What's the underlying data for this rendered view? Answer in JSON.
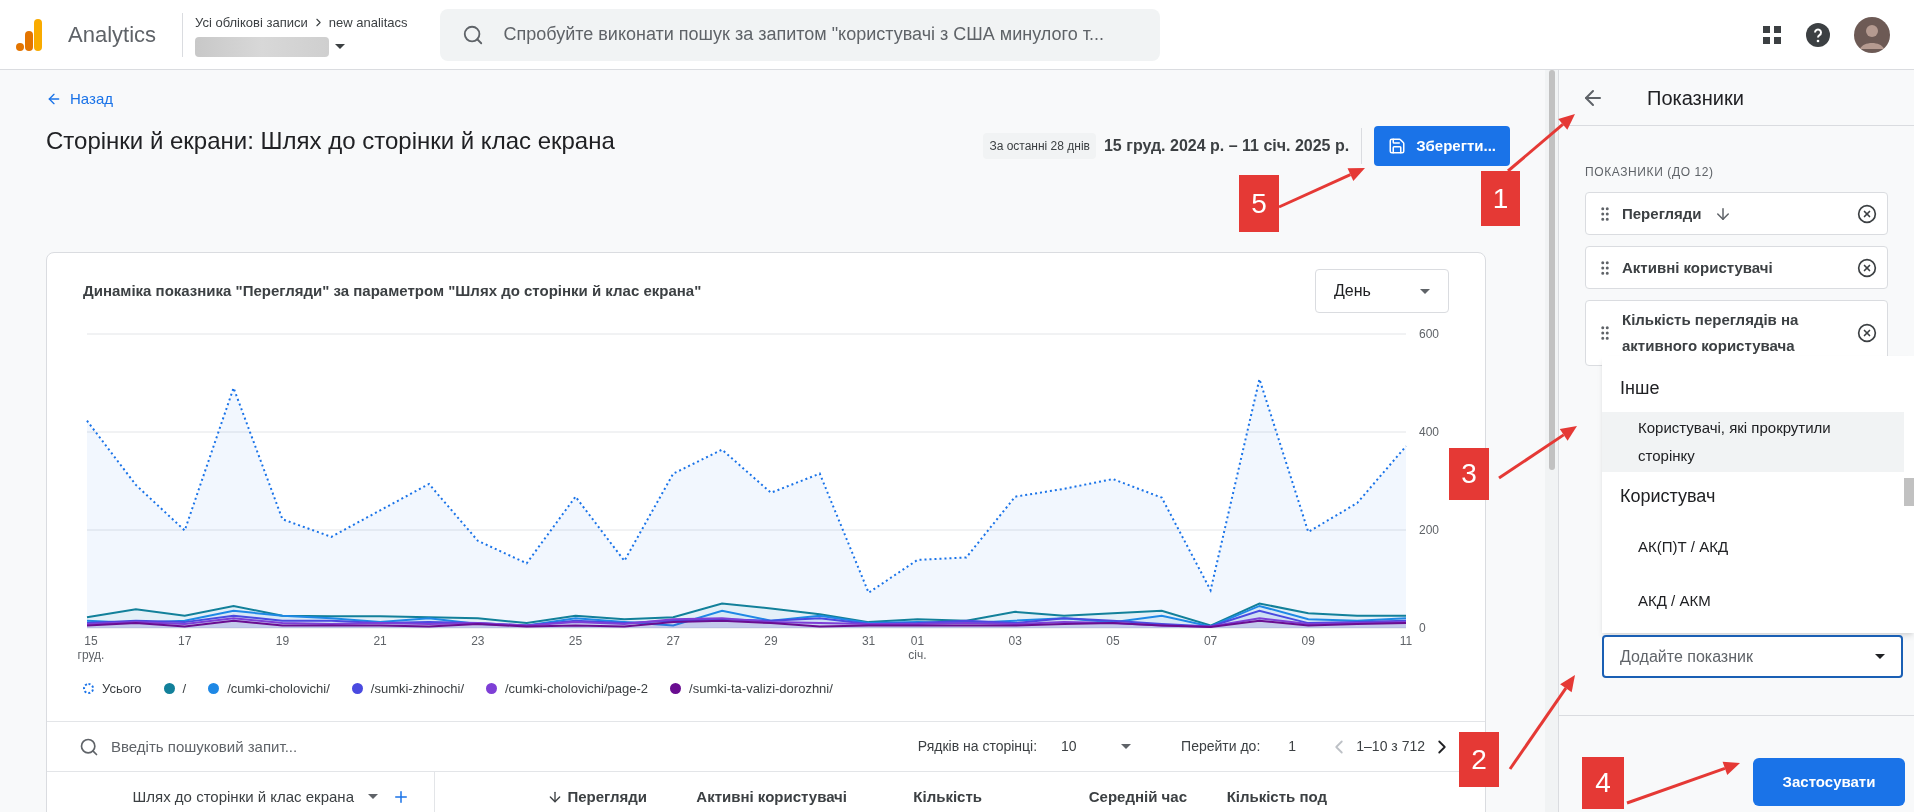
{
  "top_bar": {
    "product": "Analytics",
    "breadcrumb": [
      "Усі облікові записи",
      "new analitacs"
    ],
    "search": {
      "placeholder": "Спробуйте виконати пошук за запитом \"користувачі з США минулого т..."
    }
  },
  "header": {
    "back": "Назад",
    "title": "Сторінки й екрани: Шлях до сторінки й клас екрана",
    "date_range_label": "За останні 28 днів",
    "date_range": "15 груд. 2024 р. – 11 січ. 2025 р.",
    "save": "Зберегти..."
  },
  "chart_card": {
    "title": "Динаміка показника \"Перегляди\" за параметром \"Шлях до сторінки й клас екрана\"",
    "granularity": "День",
    "chart_data": {
      "type": "area",
      "categories": [
        "15 груд.",
        null,
        "17",
        null,
        "19",
        null,
        "21",
        null,
        "23",
        null,
        "25",
        null,
        "27",
        null,
        "29",
        null,
        "31",
        "01 січ.",
        null,
        "03",
        null,
        "05",
        null,
        "07",
        null,
        "09",
        null,
        "11"
      ],
      "yticks": [
        0,
        200,
        400,
        600
      ],
      "ylim": [
        0,
        600
      ],
      "series": [
        {
          "name": "Усього",
          "color": "#1a73e8",
          "line_style": "dotted",
          "values": [
            423,
            292,
            199,
            490,
            222,
            186,
            240,
            294,
            178,
            132,
            268,
            137,
            315,
            364,
            276,
            315,
            72,
            139,
            144,
            268,
            284,
            304,
            266,
            77,
            508,
            196,
            255,
            371
          ]
        },
        {
          "name": "/",
          "color": "#12809a",
          "line_style": "solid",
          "values": [
            22,
            38,
            25,
            45,
            25,
            24,
            24,
            22,
            20,
            10,
            25,
            18,
            22,
            50,
            40,
            28,
            12,
            18,
            15,
            33,
            25,
            30,
            35,
            5,
            50,
            30,
            25,
            25
          ]
        },
        {
          "name": "/cumki-cholovichi/",
          "color": "#1e88e5",
          "line_style": "solid",
          "values": [
            15,
            10,
            15,
            35,
            25,
            20,
            12,
            20,
            8,
            5,
            20,
            12,
            5,
            35,
            15,
            25,
            10,
            12,
            10,
            15,
            20,
            12,
            25,
            3,
            45,
            18,
            15,
            20
          ]
        },
        {
          "name": "/sumki-zhinochi/",
          "color": "#4a4ae0",
          "line_style": "solid",
          "values": [
            10,
            15,
            12,
            25,
            15,
            15,
            10,
            12,
            10,
            5,
            15,
            10,
            15,
            18,
            15,
            20,
            8,
            10,
            15,
            10,
            20,
            15,
            8,
            3,
            35,
            10,
            12,
            15
          ]
        },
        {
          "name": "/cumki-cholovichi/page-2",
          "color": "#7e3fd6",
          "line_style": "solid",
          "values": [
            8,
            12,
            8,
            20,
            10,
            8,
            10,
            8,
            10,
            5,
            12,
            8,
            18,
            20,
            12,
            10,
            8,
            8,
            10,
            8,
            12,
            10,
            5,
            3,
            20,
            8,
            10,
            12
          ]
        },
        {
          "name": "/sumki-ta-valizi-dorozhni/",
          "color": "#6a0d91",
          "line_style": "solid",
          "values": [
            5,
            10,
            3,
            15,
            5,
            5,
            5,
            3,
            8,
            3,
            5,
            3,
            12,
            15,
            10,
            3,
            5,
            5,
            5,
            5,
            8,
            10,
            5,
            2,
            15,
            5,
            8,
            10
          ]
        }
      ]
    }
  },
  "table": {
    "search": {
      "placeholder": "Введіть пошуковий запит..."
    },
    "rows_per_page_label": "Рядків на сторінці:",
    "rows_per_page": "10",
    "goto_label": "Перейти до:",
    "goto": "1",
    "range": "1–10 з 712",
    "columns": [
      {
        "label": "Шлях до сторінки й клас екрана",
        "kind": "dimension",
        "sorted": false
      },
      {
        "label": "Перегляди",
        "kind": "metric",
        "sorted": true
      },
      {
        "label": "Активні користувачі",
        "kind": "metric",
        "sorted": false
      },
      {
        "label": "Кількість",
        "kind": "metric",
        "sorted": false
      },
      {
        "label": "Середній час",
        "kind": "metric",
        "sorted": false
      },
      {
        "label": "Кількість под",
        "kind": "metric",
        "sorted": false
      }
    ]
  },
  "panel": {
    "title": "Показники",
    "section_label": "ПОКАЗНИКИ (ДО 12)",
    "metrics": [
      {
        "label": "Перегляди",
        "sorted": true
      },
      {
        "label": "Активні користувачі",
        "sorted": false
      },
      {
        "label": "Кількість переглядів на активного користувача",
        "sorted": false
      }
    ],
    "menu": [
      {
        "group": "Інше",
        "items": [
          {
            "label": "Користувачі, які прокрутили сторінку",
            "selected": true
          }
        ]
      },
      {
        "group": "Користувач",
        "items": [
          {
            "label": "АК(П)Т / АКД",
            "selected": false
          },
          {
            "label": "АКД / АКМ",
            "selected": false
          }
        ]
      }
    ],
    "add_metric": {
      "placeholder": "Додайте показник"
    },
    "apply": "Застосувати"
  },
  "annotations": [
    {
      "label": "1"
    },
    {
      "label": "2"
    },
    {
      "label": "3"
    },
    {
      "label": "4"
    },
    {
      "label": "5"
    }
  ]
}
